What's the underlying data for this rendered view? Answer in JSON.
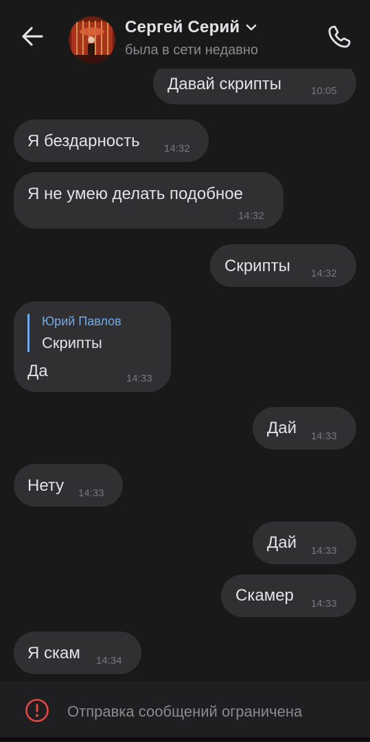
{
  "header": {
    "contact_name": "Сергей Серий",
    "status": "была в сети недавно"
  },
  "icons": {
    "back": "arrow-left-icon",
    "dropdown": "chevron-down-icon",
    "call": "phone-icon",
    "warning": "exclamation-circle-icon"
  },
  "colors": {
    "background": "#19191a",
    "bubble": "#303033",
    "accent": "#71aaeb",
    "warning": "#e64646"
  },
  "messages": [
    {
      "direction": "out",
      "text": "Давай скрипты",
      "time": "10:05"
    },
    {
      "direction": "in",
      "text": "Я бездарность",
      "time": "14:32"
    },
    {
      "direction": "in",
      "text": "Я не умею делать подобное",
      "time": "14:32"
    },
    {
      "direction": "out",
      "text": "Скрипты",
      "time": "14:32"
    },
    {
      "direction": "in",
      "reply_author": "Юрий Павлов",
      "reply_text": "Скрипты",
      "text": "Да",
      "time": "14:33"
    },
    {
      "direction": "out",
      "text": "Дай",
      "time": "14:33"
    },
    {
      "direction": "in",
      "text": "Нету",
      "time": "14:33"
    },
    {
      "direction": "out",
      "text": "Дай",
      "time": "14:33"
    },
    {
      "direction": "out",
      "text": "Скамер",
      "time": "14:33"
    },
    {
      "direction": "in",
      "text": "Я скам",
      "time": "14:34"
    }
  ],
  "footer": {
    "restriction_text": "Отправка сообщений ограничена"
  }
}
